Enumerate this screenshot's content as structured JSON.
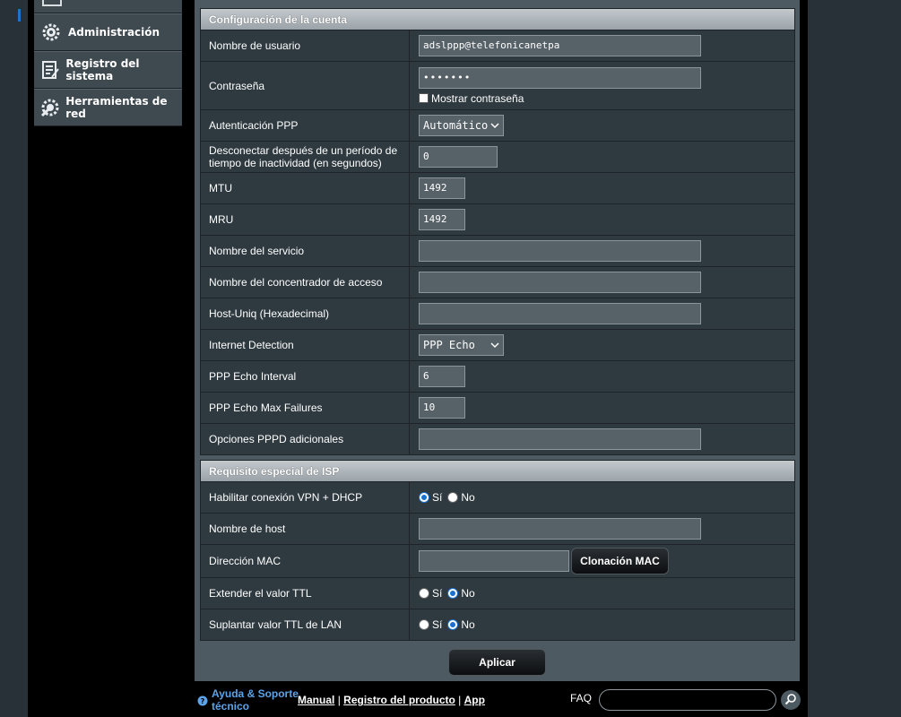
{
  "sidebar": {
    "items": [
      {
        "label": "Administración",
        "icon": "gear-icon"
      },
      {
        "label": "Registro del sistema",
        "icon": "log-icon"
      },
      {
        "label": "Herramientas de red",
        "icon": "network-tools-icon"
      }
    ]
  },
  "account": {
    "header": "Configuración de la cuenta",
    "username_label": "Nombre de usuario",
    "username_value": "adslppp@telefonicanetpa",
    "password_label": "Contraseña",
    "password_value": "•••••••",
    "show_password_label": "Mostrar contraseña",
    "ppp_auth_label": "Autenticación PPP",
    "ppp_auth_value": "Automático",
    "idle_label": "Desconectar después de un período de tiempo de inactividad (en segundos)",
    "idle_value": "0",
    "mtu_label": "MTU",
    "mtu_value": "1492",
    "mru_label": "MRU",
    "mru_value": "1492",
    "service_label": "Nombre del servicio",
    "service_value": "",
    "concentrator_label": "Nombre del concentrador de acceso",
    "concentrator_value": "",
    "hostuniq_label": "Host-Uniq (Hexadecimal)",
    "hostuniq_value": "",
    "detection_label": "Internet Detection",
    "detection_value": "PPP Echo",
    "echo_interval_label": "PPP Echo Interval",
    "echo_interval_value": "6",
    "echo_failures_label": "PPP Echo Max Failures",
    "echo_failures_value": "10",
    "pppd_label": "Opciones PPPD adicionales",
    "pppd_value": ""
  },
  "isp": {
    "header": "Requisito especial de ISP",
    "vpn_label": "Habilitar conexión VPN + DHCP",
    "vpn_selected": "yes",
    "hostname_label": "Nombre de host",
    "hostname_value": "",
    "mac_label": "Dirección MAC",
    "mac_value": "",
    "mac_clone_button": "Clonación MAC",
    "ttl_label": "Extender el valor TTL",
    "ttl_selected": "no",
    "spoof_ttl_label": "Suplantar valor TTL de LAN",
    "spoof_ttl_selected": "no",
    "yes": "Sí",
    "no": "No"
  },
  "apply_button": "Aplicar",
  "footer": {
    "help_text": "Ayuda & Soporte técnico",
    "manual": "Manual",
    "separator": "|",
    "register": "Registro del producto",
    "app": "App",
    "faq": "FAQ"
  },
  "colors": {
    "panel_bg": "#4d5a62",
    "row_bg": "#2f3a40",
    "accent_blue": "#1e74c7",
    "help_link": "#5ca3e8"
  }
}
